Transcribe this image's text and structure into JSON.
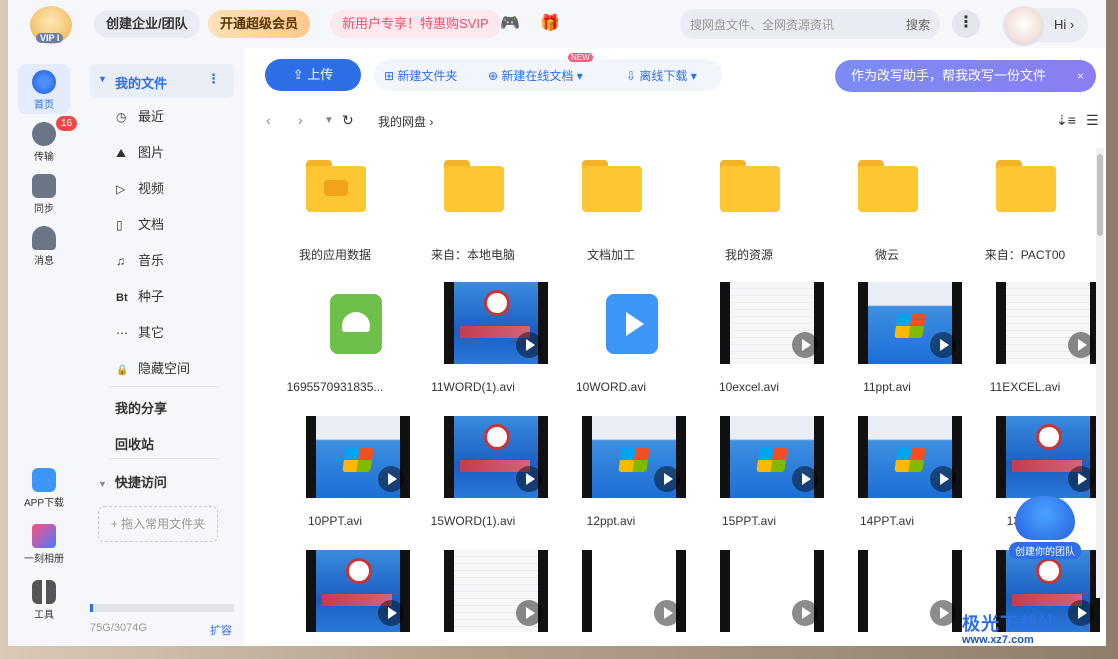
{
  "topbar": {
    "logo_text": "VIP I",
    "team_btn": "创建企业/团队",
    "vip_btn": "开通超级会员",
    "svip_btn": "新用户专享！特惠购SVIP",
    "search_placeholder": "搜网盘文件、全网资源资讯",
    "search_btn": "搜索",
    "more_btn": "⋮",
    "hi_btn": "Hi ›"
  },
  "rail": {
    "items": [
      {
        "label": "首页",
        "icon": "home-icon"
      },
      {
        "label": "传输",
        "icon": "transfer-icon",
        "badge": "16"
      },
      {
        "label": "同步",
        "icon": "sync-icon"
      },
      {
        "label": "消息",
        "icon": "message-icon"
      },
      {
        "label": "APP下载",
        "icon": "app-download-icon"
      },
      {
        "label": "一刻相册",
        "icon": "album-icon"
      },
      {
        "label": "工具",
        "icon": "tools-icon"
      }
    ]
  },
  "nav": {
    "my_files": "我的文件",
    "sub": [
      {
        "label": "最近",
        "icon": "◷"
      },
      {
        "label": "图片",
        "icon": "⛰"
      },
      {
        "label": "视频",
        "icon": "▷"
      },
      {
        "label": "文档",
        "icon": "▯"
      },
      {
        "label": "音乐",
        "icon": "♫"
      },
      {
        "label": "种子",
        "icon": "Bt"
      },
      {
        "label": "其它",
        "icon": "⋯"
      },
      {
        "label": "隐藏空间",
        "icon": "🔒"
      }
    ],
    "my_share": "我的分享",
    "recycle": "回收站",
    "quick_access": "快捷访问",
    "pin_folder": "+ 拖入常用文件夹",
    "storage_used": "75G/3074G",
    "storage_fraction": 0.024,
    "expand": "扩容"
  },
  "toolbar": {
    "upload": "上传",
    "new_folder": "新建文件夹",
    "new_doc": "新建在线文档",
    "new_tag": "NEW",
    "offline": "离线下载",
    "banner": "作为改写助手，帮我改写一份文件",
    "banner_close": "×"
  },
  "path": {
    "crumb": "我的网盘",
    "sep": "›"
  },
  "files": [
    {
      "name": "我的应用数据",
      "kind": "folder-app"
    },
    {
      "name": "来自：本地电脑",
      "kind": "folder"
    },
    {
      "name": "文档加工",
      "kind": "folder"
    },
    {
      "name": "我的资源",
      "kind": "folder"
    },
    {
      "name": "微云",
      "kind": "folder"
    },
    {
      "name": "来自：PACT00",
      "kind": "folder"
    },
    {
      "name": "1695570931835...",
      "kind": "apk"
    },
    {
      "name": "11WORD(1).avi",
      "kind": "video-blue"
    },
    {
      "name": "10WORD.avi",
      "kind": "video-icon"
    },
    {
      "name": "10excel.avi",
      "kind": "video-doc"
    },
    {
      "name": "11ppt.avi",
      "kind": "video-win"
    },
    {
      "name": "11EXCEL.avi",
      "kind": "video-doc"
    },
    {
      "name": "10PPT.avi",
      "kind": "video-win"
    },
    {
      "name": "15WORD(1).avi",
      "kind": "video-blue"
    },
    {
      "name": "12ppt.avi",
      "kind": "video-win"
    },
    {
      "name": "15PPT.avi",
      "kind": "video-win"
    },
    {
      "name": "14PPT.avi",
      "kind": "video-win"
    },
    {
      "name": "13PPT",
      "kind": "video-blue"
    },
    {
      "name": "",
      "kind": "video-blue"
    },
    {
      "name": "",
      "kind": "video-doc"
    },
    {
      "name": "",
      "kind": "video-sheet"
    },
    {
      "name": "",
      "kind": "video-sheet"
    },
    {
      "name": "",
      "kind": "video-sheet"
    },
    {
      "name": "",
      "kind": "video-blue"
    }
  ],
  "float": {
    "team_label": "创建你的团队"
  },
  "watermark": {
    "title": "极光下载站",
    "url": "www.xz7.com"
  }
}
